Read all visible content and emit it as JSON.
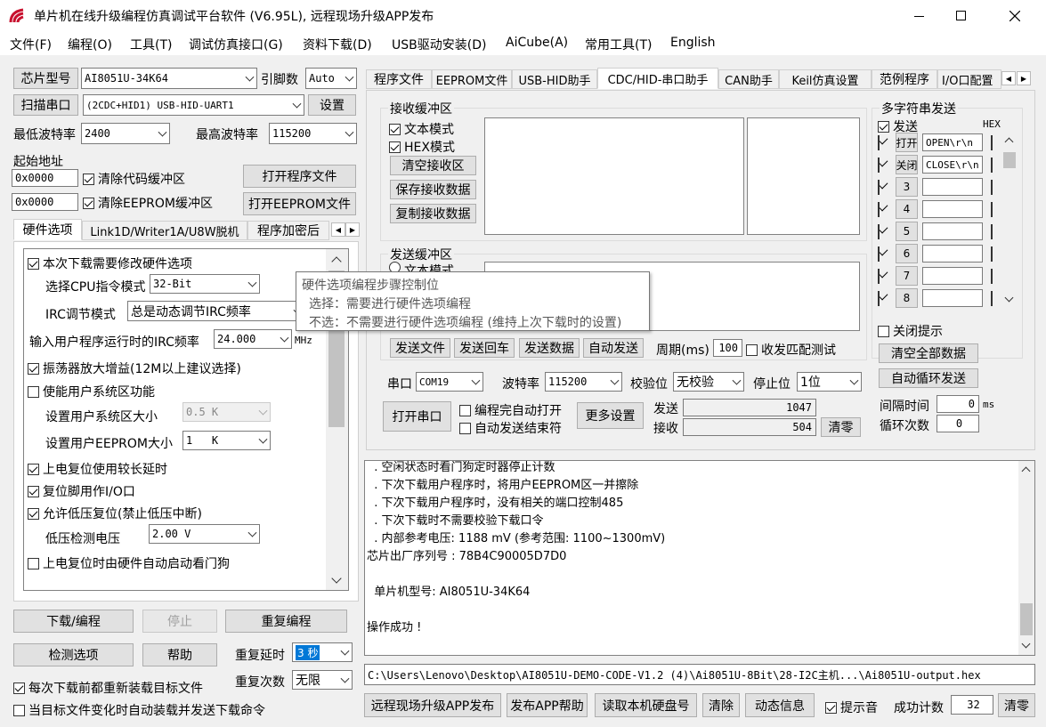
{
  "window": {
    "title": "单片机在线升级编程仿真调试平台软件 (V6.95L), 远程现场升级APP发布",
    "icon": "stc-logo-icon"
  },
  "menu": [
    "文件(F)",
    "编程(O)",
    "工具(T)",
    "调试仿真接口(G)",
    "资料下载(D)",
    "USB驱动安装(D)",
    "AiCube(A)",
    "常用工具(T)",
    "English"
  ],
  "left": {
    "chip_type_btn": "芯片型号",
    "chip_type": "AI8051U-34K64",
    "pin_label": "引脚数",
    "pin_value": "Auto",
    "scan_btn": "扫描串口",
    "port_value": "(2CDC+HID1) USB-HID-UART1",
    "settings_btn": "设置",
    "min_baud_label": "最低波特率",
    "min_baud": "2400",
    "max_baud_label": "最高波特率",
    "max_baud": "115200",
    "start_addr_label": "起始地址",
    "addr1": "0x0000",
    "clear_code_chk": "清除代码缓冲区",
    "open_prog_btn": "打开程序文件",
    "addr2": "0x0000",
    "clear_eeprom_chk": "清除EEPROM缓冲区",
    "open_eeprom_btn": "打开EEPROM文件",
    "tabs": [
      "硬件选项",
      "Link1D/Writer1A/U8W脱机",
      "程序加密后"
    ],
    "hw": {
      "opt1": "本次下载需要修改硬件选项",
      "cpu_mode_label": "选择CPU指令模式",
      "cpu_mode": "32-Bit",
      "irc_label": "IRC调节模式",
      "irc_mode": "总是动态调节IRC频率",
      "irc_freq_label": "输入用户程序运行时的IRC频率",
      "irc_freq": "24.000",
      "irc_unit": "MHz",
      "osc_gain": "振荡器放大增益(12M以上建议选择)",
      "user_sys": "使能用户系统区功能",
      "sys_size_label": "设置用户系统区大小",
      "sys_size": "0.5 K",
      "eeprom_size_label": "设置用户EEPROM大小",
      "eeprom_size": "1   K",
      "long_delay": "上电复位使用较长延时",
      "reset_io": "复位脚用作I/O口",
      "lvr": "允许低压复位(禁止低压中断)",
      "lvd_label": "低压检测电压",
      "lvd": "2.00 V",
      "wdt": "上电复位时由硬件自动启动看门狗"
    },
    "download_btn": "下载/编程",
    "stop_btn": "停止",
    "reprog_btn": "重复编程",
    "detect_btn": "检测选项",
    "help_btn": "帮助",
    "repeat_delay_label": "重复延时",
    "repeat_delay": "3 秒",
    "repeat_count_label": "重复次数",
    "repeat_count": "无限",
    "reload_chk": "每次下载前都重新装载目标文件",
    "auto_load_chk": "当目标文件变化时自动装载并发送下载命令"
  },
  "tooltip": {
    "title": "硬件选项编程步骤控制位",
    "line1": "选择：需要进行硬件选项编程",
    "line2": "不选：不需要进行硬件选项编程 (维持上次下载时的设置)"
  },
  "right": {
    "tabs": [
      "程序文件",
      "EEPROM文件",
      "USB-HID助手",
      "CDC/HID-串口助手",
      "CAN助手",
      "Keil仿真设置",
      "范例程序",
      "I/O口配置"
    ],
    "recv_group": "接收缓冲区",
    "recv_text_mode": "文本模式",
    "recv_hex_mode": "HEX模式",
    "clear_recv_btn": "清空接收区",
    "save_recv_btn": "保存接收数据",
    "copy_recv_btn": "复制接收数据",
    "send_group": "发送缓冲区",
    "send_text_mode": "文本模式",
    "send_file_btn": "发送文件",
    "send_return_btn": "发送回车",
    "send_data_btn": "发送数据",
    "auto_send_btn": "自动发送",
    "period_label": "周期(ms)",
    "period": "100",
    "match_test": "收发匹配测试",
    "port_label": "串口",
    "port": "COM19",
    "baud_label": "波特率",
    "baud": "115200",
    "parity_label": "校验位",
    "parity": "无校验",
    "stop_label": "停止位",
    "stop": "1位",
    "open_port_btn": "打开串口",
    "auto_open": "编程完自动打开",
    "auto_close": "自动发送结束符",
    "more_btn": "更多设置",
    "send_label": "发送",
    "send_count": "1047",
    "recv_label": "接收",
    "recv_count": "504",
    "clear_btn": "清零",
    "multi": {
      "title": "多字符串发送",
      "send_col": "发送",
      "hex_col": "HEX",
      "rows": [
        {
          "btn": "打开",
          "text": "OPEN\\r\\n"
        },
        {
          "btn": "关闭",
          "text": "CLOSE\\r\\n"
        },
        {
          "btn": "3",
          "text": ""
        },
        {
          "btn": "4",
          "text": ""
        },
        {
          "btn": "5",
          "text": ""
        },
        {
          "btn": "6",
          "text": ""
        },
        {
          "btn": "7",
          "text": ""
        },
        {
          "btn": "8",
          "text": ""
        }
      ],
      "close_tip": "关闭提示",
      "clear_all_btn": "清空全部数据",
      "auto_loop_btn": "自动循环发送",
      "interval_label": "间隔时间",
      "interval": "0",
      "interval_unit": "ms",
      "loop_label": "循环次数",
      "loop": "0"
    },
    "log": [
      "  . 空闲状态时看门狗定时器停止计数",
      "  . 下次下载用户程序时，将用户EEPROM区一并擦除",
      "  . 下次下载用户程序时，没有相关的端口控制485",
      "  . 下次下载时不需要校验下载口令",
      "  . 内部参考电压: 1188 mV (参考范围: 1100~1300mV)",
      "芯片出厂序列号 : 78B4C90005D7D0",
      "",
      "  单片机型号: AI8051U-34K64",
      "",
      "操作成功 !"
    ],
    "path": "C:\\Users\\Lenovo\\Desktop\\AI8051U-DEMO-CODE-V1.2 (4)\\Ai8051U-8Bit\\28-I2C主机...\\Ai8051U-output.hex",
    "bottom": {
      "remote_btn": "远程现场升级APP发布",
      "publish_help_btn": "发布APP帮助",
      "read_disk_btn": "读取本机硬盘号",
      "clear_btn": "清除",
      "dynamic_btn": "动态信息",
      "beep_chk": "提示音",
      "success_label": "成功计数",
      "success_count": "32",
      "zero_btn": "清零"
    }
  }
}
